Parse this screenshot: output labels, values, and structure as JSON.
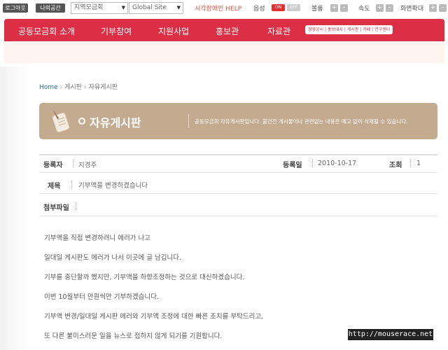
{
  "topbar": {
    "logout": "로그아웃",
    "mine": "나의공간",
    "region_select": "지역모금회",
    "global_select": "Global Site",
    "help": "시각장애인 HELP",
    "voice": "음성",
    "voice_on": "ON",
    "voice_off": "OFF",
    "volume": "볼륨",
    "speed": "속도",
    "zoom": "화면확대",
    "plus": "+",
    "minus": "-"
  },
  "nav": {
    "items": [
      "공동모금회 소개",
      "기부참여",
      "지원사업",
      "홍보관",
      "자료관"
    ],
    "quick_links": "경영공시 | 홍보대사 | 게시판 | 카페 | 연구센터"
  },
  "breadcrumb": [
    "Home",
    "게시판",
    "자유게시판"
  ],
  "banner": {
    "title": "자유게시판",
    "desc": "공동모금회 자유게시판입니다. 불건전 게시물이나 관련없는 내용은 예고 없이 삭제될 수 있습니다."
  },
  "post": {
    "author_label": "등록자",
    "author": "지경주",
    "date_label": "등록일",
    "date": "2010-10-17",
    "views_label": "조회",
    "views": "1",
    "subject_label": "제목",
    "subject": "기부액을 변경하겠습니다",
    "attach_label": "첨부파일",
    "body": [
      "기부액을 직접 변경하려니 에러가 나고",
      "일대일 게시판도 에러가 나서 이곳에 글 남깁니다.",
      "기부를 중단할까 했지만, 기부액을 하향조정하는 것으로 대신하겠습니다.",
      "이번 10월부터 만원씩만 기부하겠습니다.",
      "기부액 변경/일대일 게시판 에러와 기부액 조정에 대한 빠른 조치를 부탁드리고,",
      "또 다른 불미스러운 일을 뉴스로 접하지 않게 되기를 기원합니다."
    ]
  },
  "watermark": "http://mouserace.net",
  "colors": {
    "nav_red": "#dc2f45",
    "banner_tan": "#c3ab90",
    "link_blue": "#2a6e9e"
  }
}
